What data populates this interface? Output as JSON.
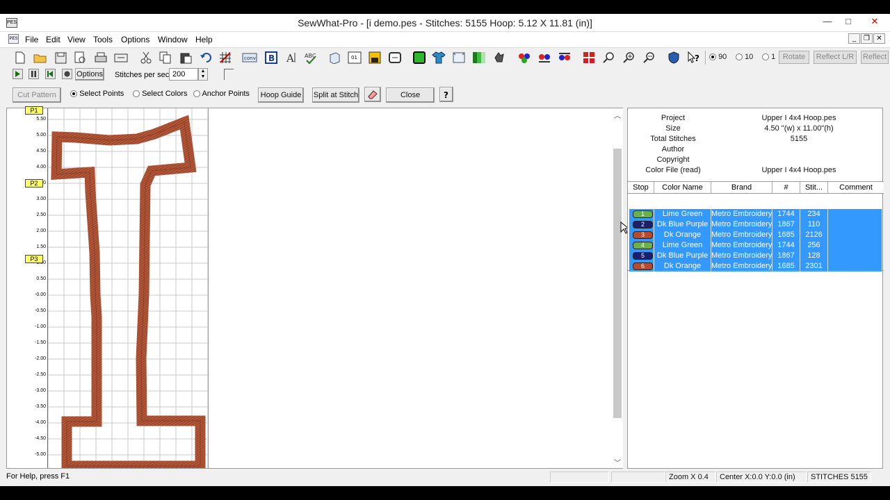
{
  "window": {
    "title": "SewWhat-Pro - [i demo.pes - Stitches: 5155  Hoop: 5.12 X 11.81 (in)]",
    "app_icon": "PES",
    "minimize": "—",
    "maximize": "□",
    "close": "✕"
  },
  "menu": {
    "items": [
      "File",
      "Edit",
      "View",
      "Tools",
      "Options",
      "Window",
      "Help"
    ],
    "mdi_minimize": "_",
    "mdi_restore": "❐",
    "mdi_close": "✕"
  },
  "toolbar1": {
    "radio_options": [
      "90",
      "10",
      "1"
    ],
    "selected_radio": "90",
    "rotate_label": "Rotate",
    "reflect_lr_label": "Reflect L/R",
    "reflect_tb_label": "Reflect"
  },
  "toolbar2": {
    "options_label": "Options",
    "stitches_per_sec_label": "Stitches per sec",
    "stitches_per_sec_value": "200"
  },
  "toolbar3": {
    "cut_pattern": "Cut Pattern",
    "select_points": "Select Points",
    "select_colors": "Select Colors",
    "anchor_points": "Anchor Points",
    "selected_mode": "Select Points",
    "hoop_guide": "Hoop Guide",
    "split_at_stitch": "Split at Stitch",
    "close": "Close"
  },
  "ruler": {
    "ticks": [
      "5.50",
      "5.00",
      "4.50",
      "4.00",
      "3.50",
      "3.00",
      "2.50",
      "2.00",
      "1.50",
      "1.00",
      "0.50",
      "-0.00",
      "-0.50",
      "-1.00",
      "-1.50",
      "-2.00",
      "-2.50",
      "-3.00",
      "-3.50",
      "-4.00",
      "-4.50",
      "-5.00"
    ],
    "markers": [
      "P1",
      "P2",
      "P3"
    ]
  },
  "design": {
    "letter_color": "#b55a3c",
    "letter_edge_color": "#7f3a24",
    "grid_color": "#c8c8c8"
  },
  "info": {
    "labels": [
      "Project",
      "Size",
      "Total Stitches",
      "Author",
      "Copyright",
      "Color File (read)"
    ],
    "values": [
      "Upper I 4x4 Hoop.pes",
      "4.50 \"(w) x 11.00\"(h)",
      "5155",
      "",
      "",
      "Upper I 4x4 Hoop.pes"
    ]
  },
  "color_table": {
    "headers": [
      "Stop",
      "Color Name",
      "Brand",
      "#",
      "Stit...",
      "Comment"
    ],
    "rows": [
      {
        "stop": "1",
        "color_name": "Lime Green",
        "brand": "Metro Embroidery",
        "number": "1744",
        "stitches": "234",
        "comment": "",
        "swatch": "#6ab04c"
      },
      {
        "stop": "2",
        "color_name": "Dk Blue Purple",
        "brand": "Metro Embroidery",
        "number": "1867",
        "stitches": "110",
        "comment": "",
        "swatch": "#1a1f6e"
      },
      {
        "stop": "3",
        "color_name": "Dk Orange",
        "brand": "Metro Embroidery",
        "number": "1685",
        "stitches": "2126",
        "comment": "",
        "swatch": "#b84a2c"
      },
      {
        "stop": "4",
        "color_name": "Lime Green",
        "brand": "Metro Embroidery",
        "number": "1744",
        "stitches": "256",
        "comment": "",
        "swatch": "#6ab04c"
      },
      {
        "stop": "5",
        "color_name": "Dk Blue Purple",
        "brand": "Metro Embroidery",
        "number": "1867",
        "stitches": "128",
        "comment": "",
        "swatch": "#1a1f6e"
      },
      {
        "stop": "6",
        "color_name": "Dk Orange",
        "brand": "Metro Embroidery",
        "number": "1685",
        "stitches": "2301",
        "comment": "",
        "swatch": "#b84a2c"
      }
    ],
    "selection_color": "#3399ff"
  },
  "status": {
    "help": "For Help, press F1",
    "zoom": "Zoom X 0.4",
    "center": "Center X:0.0 Y:0.0 (in)",
    "stitches": "STITCHES  5155"
  }
}
